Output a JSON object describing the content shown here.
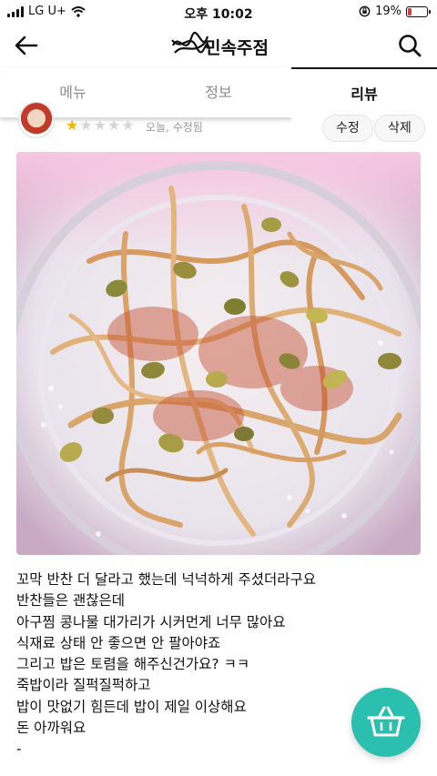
{
  "status_bar": {
    "carrier": "LG U+",
    "time": "오후 10:02",
    "battery_percent": "19%",
    "battery_level": 0.19,
    "signal_bars": 4,
    "icons": [
      "signal-icon",
      "wifi-icon",
      "orientation-lock-icon",
      "battery-icon"
    ]
  },
  "header": {
    "title": "민속주점",
    "back_icon": "back-arrow-icon",
    "search_icon": "search-icon"
  },
  "tabs": [
    {
      "label": "메뉴",
      "active": false
    },
    {
      "label": "정보",
      "active": false
    },
    {
      "label": "리뷰",
      "active": true
    }
  ],
  "review": {
    "rating": 1,
    "max_rating": 5,
    "date": "오늘, 수정됨",
    "edit_label": "수정",
    "delete_label": "삭제",
    "text_lines": [
      "꼬막 반찬 더 달라고 했는데 넉넉하게 주셨더라구요",
      "반찬들은 괜찮은데",
      "아구찜 콩나물 대가리가 시커먼게 너무 많아요",
      "식재료 상태 안 좋으면 안 팔아야죠",
      "그리고 밥은 토렴을 해주신건가요? ㅋㅋ",
      "죽밥이라 질퍽질퍽하고",
      "밥이 맛없기 힘든데 밥이 제일 이상해요",
      "돈 아까워요",
      "-"
    ]
  },
  "cart_button": {
    "icon": "shopping-basket-icon"
  },
  "colors": {
    "accent": "#2bbfb0",
    "star_active": "#f4b400",
    "star_inactive": "#d6d6d6",
    "battery_low": "#e23b3b"
  }
}
